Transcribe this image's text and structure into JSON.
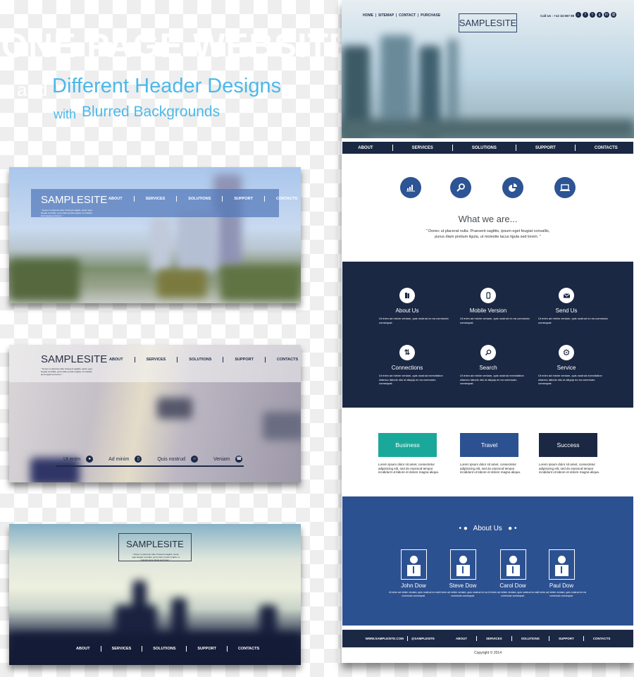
{
  "headline": {
    "title": "ONE PAGE WEBSITE",
    "and": "and",
    "subtitle": "Different Header Designs",
    "with": "with",
    "subtitle2": "Blurred Backgrounds",
    "accent_color": "#4cb8ea"
  },
  "site_name": "SAMPLESITE",
  "quote_text": "\" Donec ut placerat nulla. Praesent sagittis, ipsum eget feugiat convallis, purus diam pretium ligula, ut molestie lacus ligula sed lorem. \"",
  "nav": [
    "ABOUT",
    "SERVICES",
    "SOLUTIONS",
    "SUPPORT",
    "CONTACTS"
  ],
  "panel2_features": [
    {
      "label": "Ut enim",
      "icon": "lock-icon"
    },
    {
      "label": "Ad minim",
      "icon": "mobile-icon"
    },
    {
      "label": "Quis nostrud",
      "icon": "circle-icon"
    },
    {
      "label": "Veniam",
      "icon": "phone-icon"
    }
  ],
  "mockup": {
    "top_nav": [
      "HOME",
      "SITEMAP",
      "CONTACT",
      "PURCHASE"
    ],
    "call_us": "Call Us : +12 34 567 89",
    "social_icons": [
      "home-icon",
      "facebook-icon",
      "twitter-icon",
      "google-icon",
      "linkedin-icon",
      "mail-icon"
    ],
    "feature_icons": [
      "bar-chart-icon",
      "magnifier-icon",
      "pie-chart-icon",
      "laptop-icon"
    ],
    "what_title": "What we are...",
    "what_text_1": "\" Donec ut placerat nulla. Praesent sagittis, ipsum eget feugiat convallis,",
    "what_text_2": "purus diam pretium ligula, ut molestie lacus ligula sed lorem. \"",
    "services": [
      {
        "title": "About Us",
        "icon": "book-icon",
        "desc": "Ut enim ad minim veniam, quis nostrud ex ea commodo consequat."
      },
      {
        "title": "Mobile Version",
        "icon": "mobile-icon",
        "desc": "Ut enim ad minim veniam, quis nostrud ex ea commodo consequat."
      },
      {
        "title": "Send Us",
        "icon": "envelope-icon",
        "desc": "Ut enim ad minim veniam, quis nostrud ex ea commodo consequat."
      },
      {
        "title": "Connections",
        "icon": "exchange-icon",
        "desc": "Ut enim ad minim veniam, quis nostrud exercitation ullamco laboris nisi ut aliquip ex ea commodo consequat."
      },
      {
        "title": "Search",
        "icon": "search-icon",
        "desc": "Ut enim ad minim veniam, quis nostrud exercitation ullamco laboris nisi ut aliquip ex ea commodo consequat."
      },
      {
        "title": "Service",
        "icon": "gear-icon",
        "desc": "Ut enim ad minim veniam, quis nostrud exercitation ullamco laboris nisi ut aliquip ex ea commodo consequat."
      }
    ],
    "categories": [
      {
        "label": "Business",
        "color": "#1aa89a",
        "desc": "Lorem ipsum dolor sit amet, consectetur adipisicing elit, sed do eiusmod tempor incididunt ut labore et dolore magna aliqua."
      },
      {
        "label": "Travel",
        "color": "#2c5191",
        "desc": "Lorem ipsum dolor sit amet, consectetur adipisicing elit, sed do eiusmod tempor incididunt ut labore et dolore magna aliqua."
      },
      {
        "label": "Success",
        "color": "#1b2844",
        "desc": "Lorem ipsum dolor sit amet, consectetur adipisicing elit, sed do eiusmod tempor incididunt ut labore et dolore magna aliqua."
      }
    ],
    "team_title": "About Us",
    "team": [
      {
        "name": "John Dow",
        "desc": "Ut enim ad minim veniam, quis nostrud ex ea commodo consequat."
      },
      {
        "name": "Steve Dow",
        "desc": "Ut enim ad minim veniam, quis nostrud ex ea commodo consequat."
      },
      {
        "name": "Carol Dow",
        "desc": "Ut enim ad minim veniam, quis nostrud ex ea commodo consequat."
      },
      {
        "name": "Paul Dow",
        "desc": "Ut enim ad minim veniam, quis nostrud ex ea commodo consequat."
      }
    ],
    "footer_site": "WWW.SAMPLESITE.COM",
    "footer_handle": "@SAMPLESITE",
    "copyright": "Copyright © 2014"
  }
}
